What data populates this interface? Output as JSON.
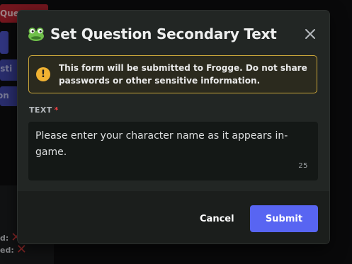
{
  "background": {
    "red_button_text": "Ques",
    "blue_button_2_text": "osti",
    "blue_button_3_text": "on",
    "row1_label": "d:",
    "row2_label": "ed:"
  },
  "modal": {
    "title": "Set Question Secondary Text",
    "warning_line1": "This form will be submitted to Frogge. Do not share",
    "warning_line2": "passwords or other sensitive information.",
    "field_label": "TEXT",
    "required_mark": "*",
    "field_value": "Please enter your character name as it appears in-game.",
    "char_count": "25",
    "cancel_label": "Cancel",
    "submit_label": "Submit"
  },
  "colors": {
    "accent": "#5865f2",
    "warning_border": "#c9a53a",
    "warning_icon": "#f0b232",
    "required": "#f23f43"
  },
  "icons": {
    "app_icon": "frog-icon",
    "close": "close-icon",
    "warning": "warning-icon",
    "status_fail": "x-icon"
  }
}
